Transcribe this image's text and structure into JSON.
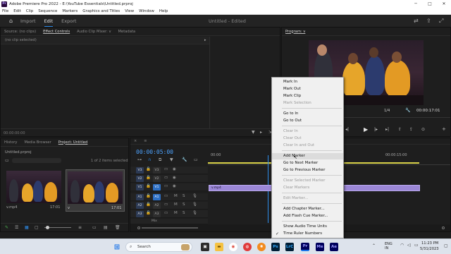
{
  "window": {
    "title": "Adobe Premiere Pro 2022 - E:\\YouTube Essentials\\Untitled.prproj",
    "app_badge": "Pr"
  },
  "menu": [
    "File",
    "Edit",
    "Clip",
    "Sequence",
    "Markers",
    "Graphics and Titles",
    "View",
    "Window",
    "Help"
  ],
  "workspace": {
    "tabs": [
      "Import",
      "Edit",
      "Export"
    ],
    "active": "Edit",
    "document": "Untitled - Edited"
  },
  "source_panel": {
    "tabs": [
      "Source: (no clips)",
      "Effect Controls",
      "Audio Clip Mixer: v",
      "Metadata"
    ],
    "active": "Effect Controls",
    "no_clip": "(no clip selected)",
    "timecode": "00:00:00:00"
  },
  "program_panel": {
    "title": "Program: v",
    "fit": "1/4",
    "timecode": "00:00:17:01"
  },
  "project_panel": {
    "tabs": [
      "History",
      "Media Browser",
      "Project: Untitled"
    ],
    "active": "Project: Untitled",
    "file": "Untitled.prproj",
    "items_info": "1 of 2 items selected",
    "items": [
      {
        "name": "v.mp4",
        "duration": "17:01"
      },
      {
        "name": "v",
        "duration": "17:01"
      }
    ]
  },
  "timeline": {
    "timecode": "00:00:05:00",
    "ruler": [
      "00:00",
      "00:00:15:00"
    ],
    "video_tracks": [
      {
        "target": "V3",
        "label": "V3"
      },
      {
        "target": "V2",
        "label": "V2"
      },
      {
        "target": "V1",
        "label": "V1"
      }
    ],
    "audio_tracks": [
      {
        "target": "A1",
        "label": "A1"
      },
      {
        "target": "A2",
        "label": "A2"
      },
      {
        "target": "A3",
        "label": "A3"
      }
    ],
    "mix_label": "Mix",
    "clip_label": "v.mp4",
    "audio_mute": "M",
    "audio_solo": "S"
  },
  "context_menu": {
    "items": [
      {
        "label": "Mark In",
        "enabled": true
      },
      {
        "label": "Mark Out",
        "enabled": true
      },
      {
        "label": "Mark Clip",
        "enabled": true
      },
      {
        "label": "Mark Selection",
        "enabled": false
      },
      {
        "sep": true
      },
      {
        "label": "Go to In",
        "enabled": true
      },
      {
        "label": "Go to Out",
        "enabled": true
      },
      {
        "sep": true
      },
      {
        "label": "Clear In",
        "enabled": false
      },
      {
        "label": "Clear Out",
        "enabled": false
      },
      {
        "label": "Clear In and Out",
        "enabled": false
      },
      {
        "sep": true
      },
      {
        "label": "Add Marker",
        "enabled": true,
        "highlighted": true
      },
      {
        "label": "Go to Next Marker",
        "enabled": true
      },
      {
        "label": "Go to Previous Marker",
        "enabled": true
      },
      {
        "sep": true
      },
      {
        "label": "Clear Selected Marker",
        "enabled": false
      },
      {
        "label": "Clear Markers",
        "enabled": false
      },
      {
        "sep": true
      },
      {
        "label": "Edit Marker...",
        "enabled": false
      },
      {
        "sep": true
      },
      {
        "label": "Add Chapter Marker...",
        "enabled": true
      },
      {
        "label": "Add Flash Cue Marker...",
        "enabled": true
      },
      {
        "sep": true
      },
      {
        "label": "Show Audio Time Units",
        "enabled": true
      },
      {
        "label": "Time Ruler Numbers",
        "enabled": true,
        "checked": true
      }
    ]
  },
  "taskbar": {
    "search": "Search",
    "lang": "ENG\nIN",
    "time": "11:23 PM",
    "date": "5/31/2023",
    "apps": [
      "Ps",
      "LrC",
      "Pr",
      "Me",
      "Ae"
    ]
  },
  "colors": {
    "accent": "#2d8ceb",
    "playhead": "#2d8ceb",
    "clip": "#9b87d6",
    "tl_timecode": "#4da3ff"
  }
}
